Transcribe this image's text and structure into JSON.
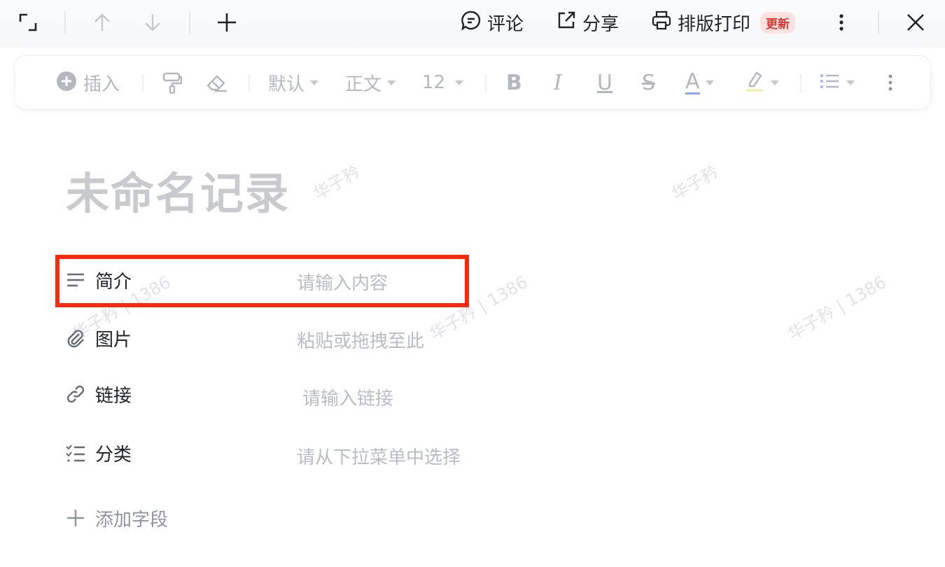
{
  "topbar": {
    "icons": [
      "expand-icon",
      "arrow-up-icon",
      "arrow-down-icon",
      "plus-icon",
      "more-icon",
      "close-icon"
    ],
    "comment_label": "评论",
    "share_label": "分享",
    "print_label": "排版打印",
    "print_badge": "更新"
  },
  "toolbar": {
    "insert_label": "插入",
    "style_value": "默认",
    "paragraph_value": "正文",
    "font_size_value": "12",
    "bold_label": "B",
    "italic_label": "I",
    "underline_label": "U",
    "strike_label": "S",
    "font_color_label": "A",
    "font_color_underline": "#8fa6f7",
    "highlight_underline": "#f7e9a6"
  },
  "document": {
    "title": "未命名记录",
    "fields": [
      {
        "label": "简介",
        "placeholder": "请输入内容",
        "icon": "text-lines-icon"
      },
      {
        "label": "图片",
        "placeholder": "粘贴或拖拽至此",
        "icon": "paperclip-icon"
      },
      {
        "label": "链接",
        "placeholder": "请输入链接",
        "icon": "link-icon"
      },
      {
        "label": "分类",
        "placeholder": "请从下拉菜单中选择",
        "icon": "checklist-icon"
      }
    ],
    "add_field_label": "添加字段"
  },
  "watermark": {
    "text_name": "华子矜",
    "text_full": "华子矜 | 1386"
  },
  "colors": {
    "highlight_box": "#fb2a0f",
    "badge_bg": "#fde2e0",
    "badge_text": "#d83931",
    "title": "#c9cacd",
    "placeholder": "#b9bcc4"
  }
}
